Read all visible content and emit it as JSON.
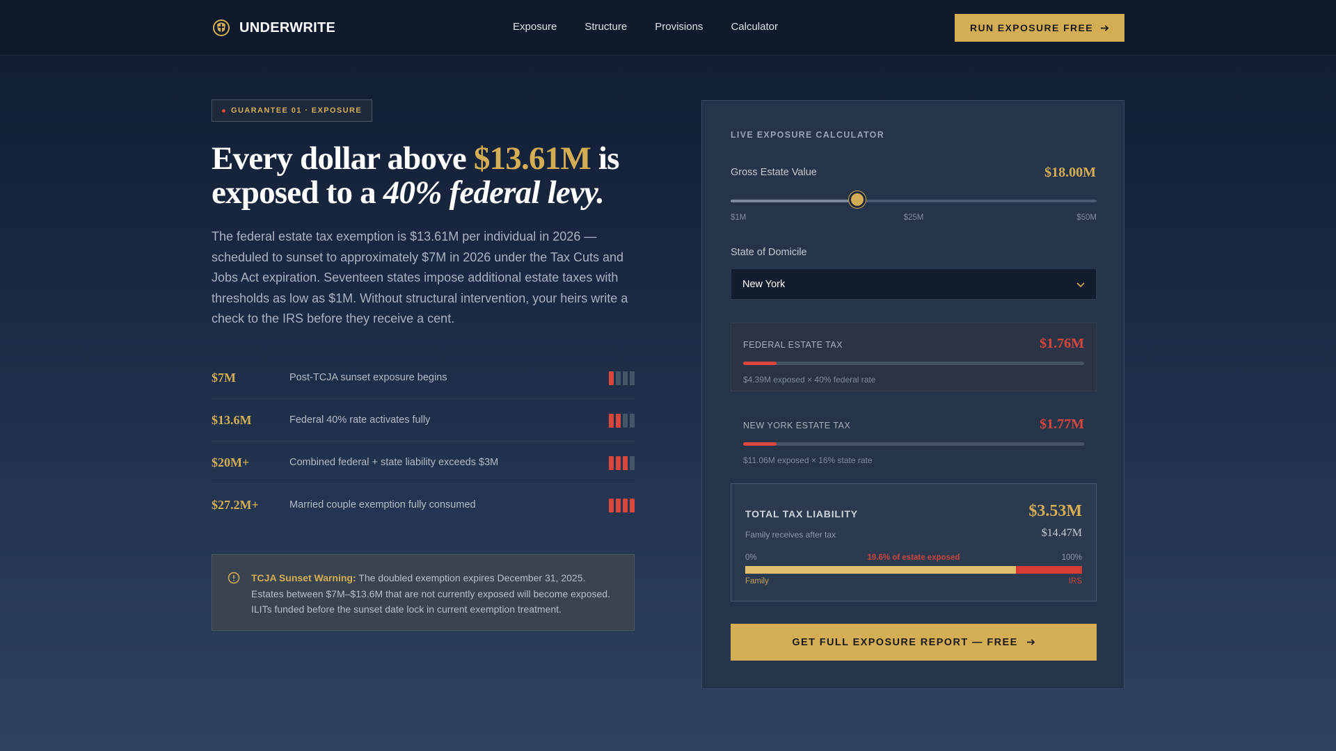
{
  "brand": {
    "name": "UNDERWRITE",
    "logo_icon": "shield-crest-icon"
  },
  "nav": {
    "items": [
      "Exposure",
      "Structure",
      "Provisions",
      "Calculator"
    ]
  },
  "header_cta": {
    "label": "RUN EXPOSURE FREE",
    "icon": "arrow-right-icon"
  },
  "badge": {
    "label": "GUARANTEE 01 · EXPOSURE"
  },
  "headline": {
    "part1": "Every dollar above ",
    "amount": "$13.61M",
    "part2": " is exposed to a ",
    "emphasis": "40% federal levy."
  },
  "lede": "The federal estate tax exemption is $13.61M per individual in 2026 — scheduled to sunset to approximately $7M in 2026 under the Tax Cuts and Jobs Act expiration. Seventeen states impose additional estate taxes with thresholds as low as $1M. Without structural intervention, your heirs write a check to the IRS before they receive a cent.",
  "thresholds": [
    {
      "value": "$7M",
      "desc": "Post-TCJA sunset exposure begins",
      "level": 1
    },
    {
      "value": "$13.6M",
      "desc": "Federal 40% rate activates fully",
      "level": 2
    },
    {
      "value": "$20M+",
      "desc": "Combined federal + state liability exceeds $3M",
      "level": 3
    },
    {
      "value": "$27.2M+",
      "desc": "Married couple exemption fully consumed",
      "level": 4
    }
  ],
  "warning": {
    "title": "TCJA Sunset Warning:",
    "text": " The doubled exemption expires December 31, 2025. Estates between $7M–$13.6M that are not currently exposed will become exposed. ILITs funded before the sunset date lock in current exemption treatment.",
    "icon": "alert-circle-icon"
  },
  "calculator": {
    "title": "LIVE EXPOSURE CALCULATOR",
    "gross_label": "Gross Estate Value",
    "gross_value": "$18.00M",
    "slider": {
      "min": 1,
      "max": 50,
      "value": 18,
      "unit": "M"
    },
    "ticks": [
      "$1M",
      "$25M",
      "$50M"
    ],
    "state_label": "State of Domicile",
    "state_value": "New York",
    "federal": {
      "name": "FEDERAL ESTATE TAX",
      "value": "$1.76M",
      "note": "$4.39M exposed × 40% federal rate",
      "fill_fraction": 0.098
    },
    "state": {
      "name": "NEW YORK ESTATE TAX",
      "value": "$1.77M",
      "note": "$11.06M exposed × 16% state rate",
      "fill_fraction": 0.098
    },
    "total": {
      "label": "TOTAL TAX LIABILITY",
      "value": "$3.53M",
      "family_label": "Family receives after tax",
      "family_value": "$14.47M",
      "left_label": "0%",
      "mid_label": "19.6% of estate exposed",
      "right_label": "100%",
      "family_fraction": 0.804,
      "family_tag": "Family",
      "irs_tag": "IRS"
    },
    "cta": {
      "label": "GET FULL EXPOSURE REPORT — FREE",
      "icon": "arrow-right-icon"
    }
  },
  "colors": {
    "gold": "#d4ae55",
    "red": "#d9473c",
    "bg": "#1a2a43"
  }
}
